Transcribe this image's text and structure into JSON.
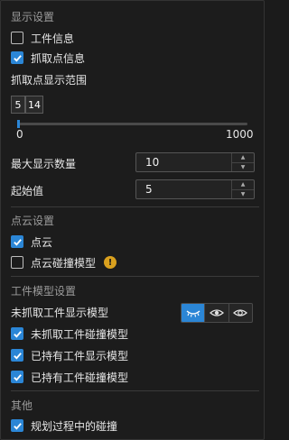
{
  "display": {
    "title": "显示设置",
    "workpiece_info": {
      "label": "工件信息",
      "checked": false
    },
    "pick_point_info": {
      "label": "抓取点信息",
      "checked": true
    },
    "pick_range_label": "抓取点显示范围",
    "range_from": "5",
    "range_to": "14",
    "slider": {
      "min": "0",
      "max": "1000",
      "value": 0.0
    },
    "max_count": {
      "label": "最大显示数量",
      "value": "10"
    },
    "start_value": {
      "label": "起始值",
      "value": "5"
    }
  },
  "pointcloud": {
    "title": "点云设置",
    "cloud": {
      "label": "点云",
      "checked": true
    },
    "collision_model": {
      "label": "点云碰撞模型",
      "checked": false
    },
    "warning_icon": "warning-icon"
  },
  "workpiece_model": {
    "title": "工件模型设置",
    "unpicked_display_label": "未抓取工件显示模型",
    "toggle_icons": [
      "eye-closed-icon",
      "eye-open-icon",
      "eye-outline-icon"
    ],
    "unpicked_collision": {
      "label": "未抓取工件碰撞模型",
      "checked": true
    },
    "held_display": {
      "label": "已持有工件显示模型",
      "checked": true
    },
    "held_collision": {
      "label": "已持有工件碰撞模型",
      "checked": true
    }
  },
  "other": {
    "title": "其他",
    "planning_collision": {
      "label": "规划过程中的碰撞",
      "checked": true
    }
  },
  "colors": {
    "accent": "#2b86d6",
    "warning": "#d9a01e",
    "background": "#1c1c1c"
  }
}
